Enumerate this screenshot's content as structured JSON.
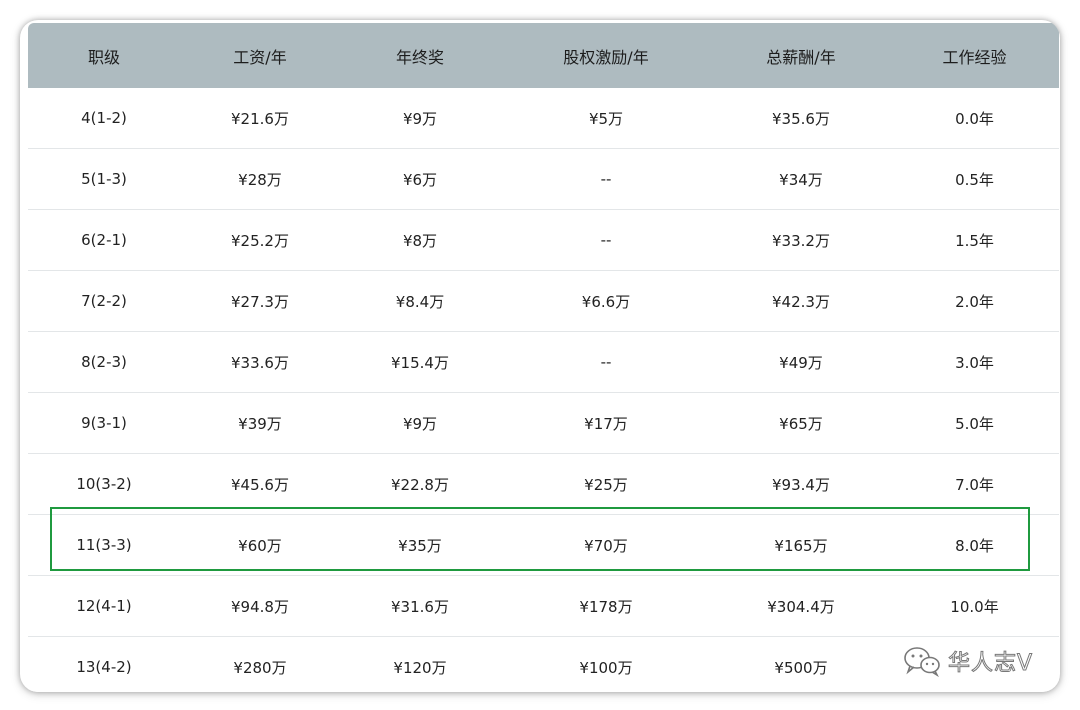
{
  "table": {
    "headers": [
      "职级",
      "工资/年",
      "年终奖",
      "股权激励/年",
      "总薪酬/年",
      "工作经验"
    ],
    "rows": [
      [
        "4(1-2)",
        "¥21.6万",
        "¥9万",
        "¥5万",
        "¥35.6万",
        "0.0年"
      ],
      [
        "5(1-3)",
        "¥28万",
        "¥6万",
        "--",
        "¥34万",
        "0.5年"
      ],
      [
        "6(2-1)",
        "¥25.2万",
        "¥8万",
        "--",
        "¥33.2万",
        "1.5年"
      ],
      [
        "7(2-2)",
        "¥27.3万",
        "¥8.4万",
        "¥6.6万",
        "¥42.3万",
        "2.0年"
      ],
      [
        "8(2-3)",
        "¥33.6万",
        "¥15.4万",
        "--",
        "¥49万",
        "3.0年"
      ],
      [
        "9(3-1)",
        "¥39万",
        "¥9万",
        "¥17万",
        "¥65万",
        "5.0年"
      ],
      [
        "10(3-2)",
        "¥45.6万",
        "¥22.8万",
        "¥25万",
        "¥93.4万",
        "7.0年"
      ],
      [
        "11(3-3)",
        "¥60万",
        "¥35万",
        "¥70万",
        "¥165万",
        "8.0年"
      ],
      [
        "12(4-1)",
        "¥94.8万",
        "¥31.6万",
        "¥178万",
        "¥304.4万",
        "10.0年"
      ],
      [
        "13(4-2)",
        "¥280万",
        "¥120万",
        "¥100万",
        "¥500万",
        ""
      ]
    ],
    "highlighted_row_index": 7
  },
  "colors": {
    "header_background": "#aebbc0",
    "highlight_border": "#1f9a3f",
    "row_divider": "#e3e6e8"
  },
  "watermark": {
    "icon": "wechat-icon",
    "text": "华人志V"
  }
}
